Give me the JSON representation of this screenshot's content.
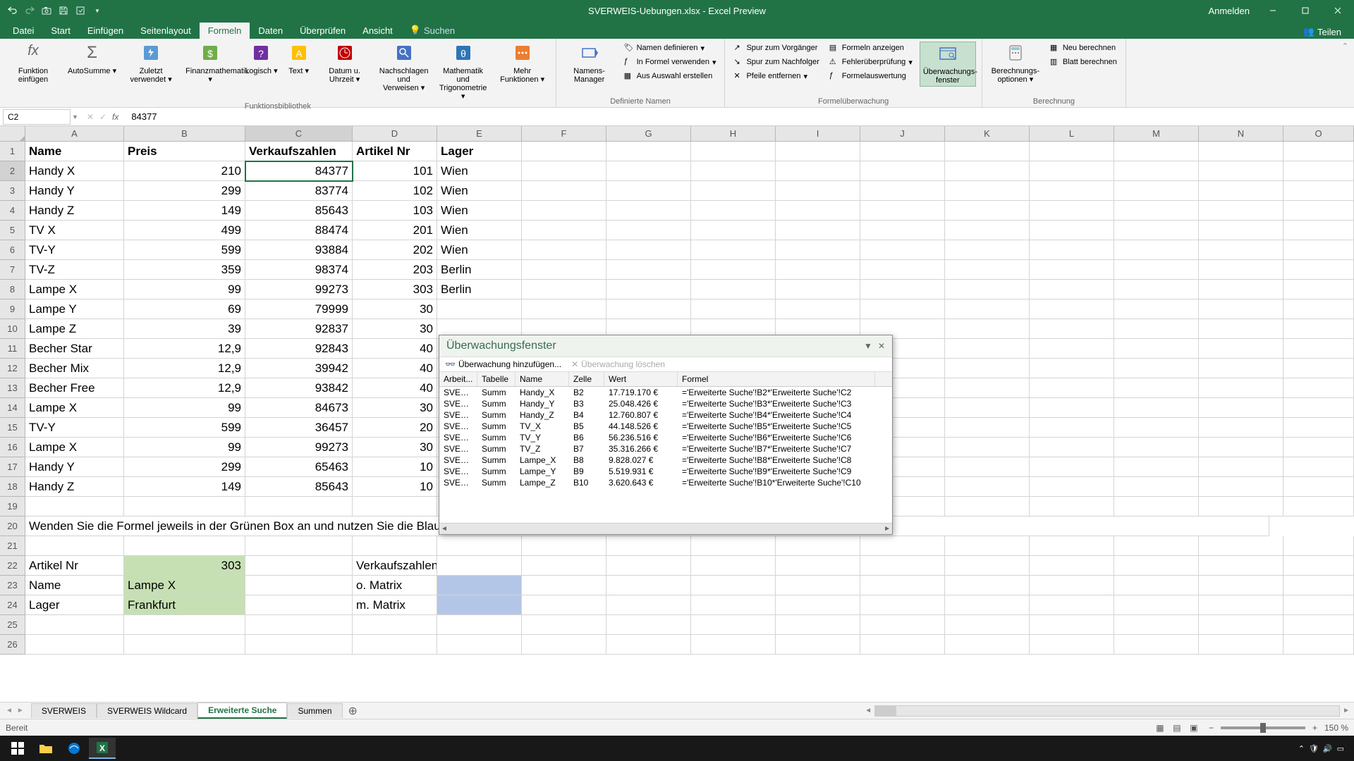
{
  "titlebar": {
    "title": "SVERWEIS-Uebungen.xlsx - Excel Preview",
    "signin": "Anmelden"
  },
  "menu": {
    "datei": "Datei",
    "start": "Start",
    "einfuegen": "Einfügen",
    "seitenlayout": "Seitenlayout",
    "formeln": "Formeln",
    "daten": "Daten",
    "ueberpruefen": "Überprüfen",
    "ansicht": "Ansicht",
    "suchen": "Suchen",
    "teilen": "Teilen"
  },
  "ribbon": {
    "funktion_einfuegen": "Funktion einfügen",
    "autosumme": "AutoSumme",
    "zuletzt": "Zuletzt verwendet",
    "finanzmath": "Finanzmathematik",
    "logisch": "Logisch",
    "text": "Text",
    "datum": "Datum u. Uhrzeit",
    "nachschlagen": "Nachschlagen und Verweisen",
    "mathtrig": "Mathematik und Trigonometrie",
    "mehr": "Mehr Funktionen",
    "group_bib": "Funktionsbibliothek",
    "namensmgr": "Namens-Manager",
    "namen_def": "Namen definieren",
    "in_formel": "In Formel verwenden",
    "aus_auswahl": "Aus Auswahl erstellen",
    "group_namen": "Definierte Namen",
    "spur_vor": "Spur zum Vorgänger",
    "spur_nach": "Spur zum Nachfolger",
    "pfeile": "Pfeile entfernen",
    "formeln_anz": "Formeln anzeigen",
    "fehler": "Fehlerüberprüfung",
    "formelaus": "Formelauswertung",
    "ueberwachung": "Überwachungs-fenster",
    "group_ueberw": "Formelüberwachung",
    "berechnung_opt": "Berechnungs-optionen",
    "neu_berechnen": "Neu berechnen",
    "blatt_berechnen": "Blatt berechnen",
    "group_berechnung": "Berechnung"
  },
  "formula": {
    "cellref": "C2",
    "value": "84377"
  },
  "colheads": [
    "A",
    "B",
    "C",
    "D",
    "E",
    "F",
    "G",
    "H",
    "I",
    "J",
    "K",
    "L",
    "M",
    "N",
    "O"
  ],
  "headers": {
    "name": "Name",
    "preis": "Preis",
    "verkauf": "Verkaufszahlen",
    "artikel": "Artikel Nr",
    "lager": "Lager"
  },
  "rows": [
    {
      "name": "Handy X",
      "preis": "210",
      "verk": "84377",
      "art": "101",
      "lager": "Wien"
    },
    {
      "name": "Handy Y",
      "preis": "299",
      "verk": "83774",
      "art": "102",
      "lager": "Wien"
    },
    {
      "name": "Handy Z",
      "preis": "149",
      "verk": "85643",
      "art": "103",
      "lager": "Wien"
    },
    {
      "name": "TV X",
      "preis": "499",
      "verk": "88474",
      "art": "201",
      "lager": "Wien"
    },
    {
      "name": "TV-Y",
      "preis": "599",
      "verk": "93884",
      "art": "202",
      "lager": "Wien"
    },
    {
      "name": "TV-Z",
      "preis": "359",
      "verk": "98374",
      "art": "203",
      "lager": "Berlin"
    },
    {
      "name": "Lampe X",
      "preis": "99",
      "verk": "99273",
      "art": "303",
      "lager": "Berlin"
    },
    {
      "name": "Lampe Y",
      "preis": "69",
      "verk": "79999",
      "art": "30",
      "lager": ""
    },
    {
      "name": "Lampe Z",
      "preis": "39",
      "verk": "92837",
      "art": "30",
      "lager": ""
    },
    {
      "name": "Becher Star",
      "preis": "12,9",
      "verk": "92843",
      "art": "40",
      "lager": ""
    },
    {
      "name": "Becher Mix",
      "preis": "12,9",
      "verk": "39942",
      "art": "40",
      "lager": ""
    },
    {
      "name": "Becher Free",
      "preis": "12,9",
      "verk": "93842",
      "art": "40",
      "lager": ""
    },
    {
      "name": "Lampe X",
      "preis": "99",
      "verk": "84673",
      "art": "30",
      "lager": ""
    },
    {
      "name": "TV-Y",
      "preis": "599",
      "verk": "36457",
      "art": "20",
      "lager": ""
    },
    {
      "name": "Lampe X",
      "preis": "99",
      "verk": "99273",
      "art": "30",
      "lager": ""
    },
    {
      "name": "Handy Y",
      "preis": "299",
      "verk": "65463",
      "art": "10",
      "lager": ""
    },
    {
      "name": "Handy Z",
      "preis": "149",
      "verk": "85643",
      "art": "10",
      "lager": ""
    }
  ],
  "instruction": "Wenden Sie die Formel jeweils in der Grünen Box an und nutzen Sie die Blaue als Suchkriterium",
  "lookup": {
    "artikel_label": "Artikel Nr",
    "artikel_val": "303",
    "name_label": "Name",
    "name_val": "Lampe X",
    "lager_label": "Lager",
    "lager_val": "Frankfurt",
    "verkauf_label": "Verkaufszahlen",
    "omatrix": "o. Matrix",
    "mmatrix": "m. Matrix"
  },
  "sheets": {
    "s1": "SVERWEIS",
    "s2": "SVERWEIS Wildcard",
    "s3": "Erweiterte Suche",
    "s4": "Summen"
  },
  "status": {
    "ready": "Bereit",
    "zoom": "150 %"
  },
  "watch": {
    "title": "Überwachungsfenster",
    "add": "Überwachung hinzufügen...",
    "del": "Überwachung löschen",
    "cols": {
      "arbeit": "Arbeit...",
      "tabelle": "Tabelle",
      "name": "Name",
      "zelle": "Zelle",
      "wert": "Wert",
      "formel": "Formel"
    },
    "rows": [
      {
        "a": "SVERW...",
        "t": "Summ",
        "n": "Handy_X",
        "z": "B2",
        "w": "17.719.170 €",
        "f": "='Erweiterte Suche'!B2*'Erweiterte Suche'!C2"
      },
      {
        "a": "SVERW...",
        "t": "Summ",
        "n": "Handy_Y",
        "z": "B3",
        "w": "25.048.426 €",
        "f": "='Erweiterte Suche'!B3*'Erweiterte Suche'!C3"
      },
      {
        "a": "SVERW...",
        "t": "Summ",
        "n": "Handy_Z",
        "z": "B4",
        "w": "12.760.807 €",
        "f": "='Erweiterte Suche'!B4*'Erweiterte Suche'!C4"
      },
      {
        "a": "SVERW...",
        "t": "Summ",
        "n": "TV_X",
        "z": "B5",
        "w": "44.148.526 €",
        "f": "='Erweiterte Suche'!B5*'Erweiterte Suche'!C5"
      },
      {
        "a": "SVERW...",
        "t": "Summ",
        "n": "TV_Y",
        "z": "B6",
        "w": "56.236.516 €",
        "f": "='Erweiterte Suche'!B6*'Erweiterte Suche'!C6"
      },
      {
        "a": "SVERW...",
        "t": "Summ",
        "n": "TV_Z",
        "z": "B7",
        "w": "35.316.266 €",
        "f": "='Erweiterte Suche'!B7*'Erweiterte Suche'!C7"
      },
      {
        "a": "SVERW...",
        "t": "Summ",
        "n": "Lampe_X",
        "z": "B8",
        "w": "9.828.027 €",
        "f": "='Erweiterte Suche'!B8*'Erweiterte Suche'!C8"
      },
      {
        "a": "SVERW...",
        "t": "Summ",
        "n": "Lampe_Y",
        "z": "B9",
        "w": "5.519.931 €",
        "f": "='Erweiterte Suche'!B9*'Erweiterte Suche'!C9"
      },
      {
        "a": "SVERW...",
        "t": "Summ",
        "n": "Lampe_Z",
        "z": "B10",
        "w": "3.620.643 €",
        "f": "='Erweiterte Suche'!B10*'Erweiterte Suche'!C10"
      }
    ]
  }
}
